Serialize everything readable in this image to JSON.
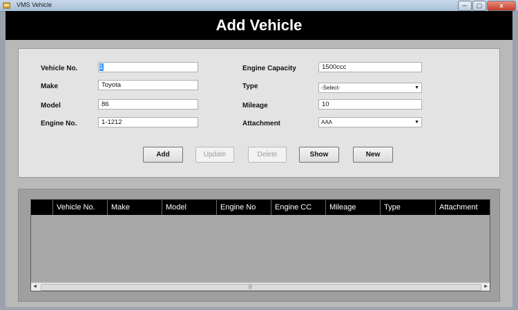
{
  "window": {
    "title": "VMS Vehicle",
    "minimize_glyph": "─",
    "restore_glyph": "▢",
    "close_glyph": "x"
  },
  "header": {
    "title": "Add Vehicle"
  },
  "form": {
    "labels": {
      "vehicle_no": "Vehicle No.",
      "make": "Make",
      "model": "Model",
      "engine_no": "Engine No.",
      "engine_capacity": "Engine Capacity",
      "type": "Type",
      "mileage": "Mileage",
      "attachment": "Attachment"
    },
    "values": {
      "vehicle_no": "1",
      "make": "Toyota",
      "model": "86",
      "engine_no": "1-1212",
      "engine_capacity": "1500ccc",
      "type": "-Select-",
      "mileage": "10",
      "attachment": "AAA"
    }
  },
  "buttons": {
    "add": "Add",
    "update": "Update",
    "delete": "Delete",
    "show": "Show",
    "new": "New"
  },
  "grid": {
    "columns": [
      "Vehicle No.",
      "Make",
      "Model",
      "Engine No",
      "Engine CC",
      "Mileage",
      "Type",
      "Attachment"
    ],
    "rows": []
  },
  "icons": {
    "dropdown_arrow": "▼",
    "scroll_left": "◀",
    "scroll_right": "▶",
    "scroll_grip": "|||"
  },
  "colors": {
    "header_bg": "#000000",
    "header_text": "#ffffff",
    "form_bg": "#e3e3e3",
    "grid_bg": "#a8a8a8"
  }
}
